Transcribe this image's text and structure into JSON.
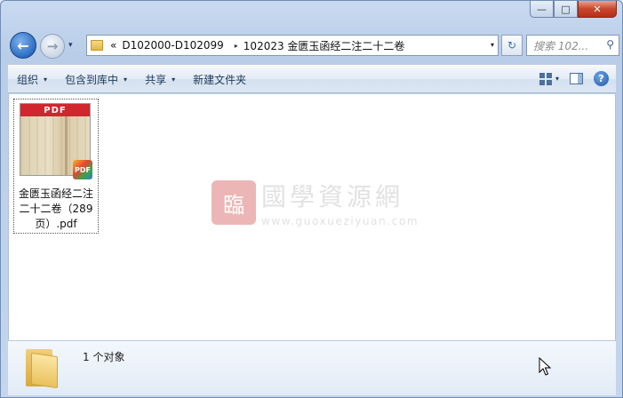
{
  "window": {
    "caption_buttons": {
      "minimize": "—",
      "maximize": "□",
      "close": "✕"
    }
  },
  "nav": {
    "back_glyph": "←",
    "forward_glyph": "→",
    "history_glyph": "▾",
    "breadcrumb": {
      "overflow": "«",
      "items": [
        "D102000-D102099",
        "102023 金匮玉函经二注二十二卷"
      ],
      "separator": "▸"
    },
    "address_dropdown": "▾",
    "refresh_glyph": "↻",
    "search": {
      "placeholder": "搜索 102...",
      "icon": "search-icon",
      "glyph": "⚲"
    }
  },
  "toolbar": {
    "items": [
      {
        "label": "组织",
        "has_menu": true
      },
      {
        "label": "包含到库中",
        "has_menu": true
      },
      {
        "label": "共享",
        "has_menu": true
      },
      {
        "label": "新建文件夹",
        "has_menu": false
      }
    ],
    "caret": "▾",
    "help_glyph": "?"
  },
  "files": [
    {
      "name": "金匮玉函经二注二十二卷（289页）.pdf",
      "thumb_label": "PDF",
      "badge_label": "PDF"
    }
  ],
  "watermark": {
    "seal": "臨",
    "title": "國學資源網",
    "url": "www.guoxueziyuan.com"
  },
  "details": {
    "selection_text": "1 个对象"
  },
  "colors": {
    "accent": "#2b6cc4",
    "thumb_band": "#d0262e",
    "toolbar_text": "#1e395b"
  }
}
